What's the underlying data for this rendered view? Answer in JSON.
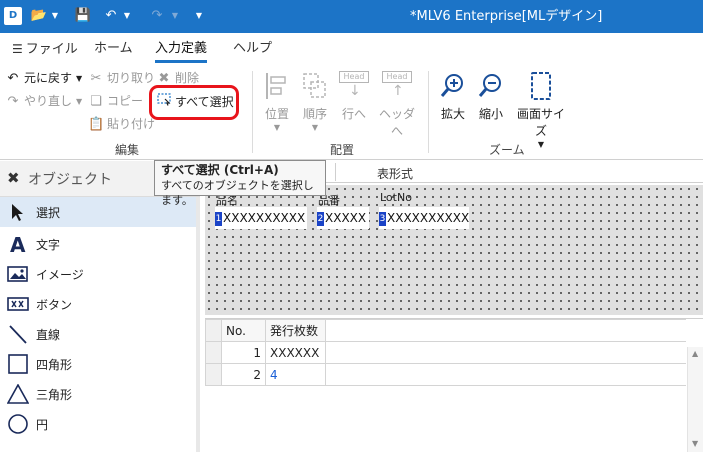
{
  "window": {
    "title": "*MLV6 Enterprise[MLデザイン]",
    "app_icon_label": "D",
    "accent_color": "#1c74c7"
  },
  "quick_access": {
    "open_icon": "folder-open-icon",
    "save_icon": "save-icon",
    "undo_icon": "undo-icon",
    "redo_icon": "redo-icon",
    "customize_icon": "customize-icon"
  },
  "ribbon_tabs": [
    {
      "label": "ファイル",
      "icon": "menu-list-icon"
    },
    {
      "label": "ホーム"
    },
    {
      "label": "入力定義",
      "active": true
    },
    {
      "label": "ヘルプ"
    }
  ],
  "ribbon": {
    "edit": {
      "label": "編集",
      "undo": "元に戻す",
      "redo": "やり直し",
      "cut": "切り取り",
      "copy": "コピー",
      "paste": "貼り付け",
      "delete": "削除",
      "select_all": "すべて選択"
    },
    "layout": {
      "label": "配置",
      "position": "位置",
      "order": "順序",
      "to_row": "行へ",
      "to_header": "ヘッダへ",
      "head_tag": "Head"
    },
    "zoom": {
      "label": "ズーム",
      "zoom_in": "拡大",
      "zoom_out": "縮小",
      "screen_size": "画面サイズ"
    }
  },
  "tooltip": {
    "title": "すべて選択 (Ctrl+A)",
    "description": "すべてのオブジェクトを選択します。"
  },
  "object_panel": {
    "title": "オブジェクト",
    "items": [
      {
        "label": "選択",
        "icon": "cursor-arrow-icon",
        "selected": true
      },
      {
        "label": "文字",
        "icon": "text-a-icon"
      },
      {
        "label": "イメージ",
        "icon": "image-icon"
      },
      {
        "label": "ボタン",
        "icon": "button-icon"
      },
      {
        "label": "直線",
        "icon": "line-icon"
      },
      {
        "label": "四角形",
        "icon": "rectangle-icon"
      },
      {
        "label": "三角形",
        "icon": "triangle-icon"
      },
      {
        "label": "円",
        "icon": "circle-icon"
      }
    ]
  },
  "doc_tabs": {
    "second_tab": "表形式"
  },
  "canvas": {
    "fields": [
      {
        "label": "品名",
        "marker": "1",
        "value": "XXXXXXXXXX"
      },
      {
        "label": "品番",
        "marker": "2",
        "value": "XXXXX"
      },
      {
        "label": "LotNo",
        "marker": "3",
        "value": "XXXXXXXXXX"
      }
    ]
  },
  "table": {
    "headers": [
      "No.",
      "発行枚数"
    ],
    "rows": [
      {
        "no": "1",
        "count": "XXXXXX"
      },
      {
        "no": "2",
        "count": "4"
      }
    ]
  }
}
